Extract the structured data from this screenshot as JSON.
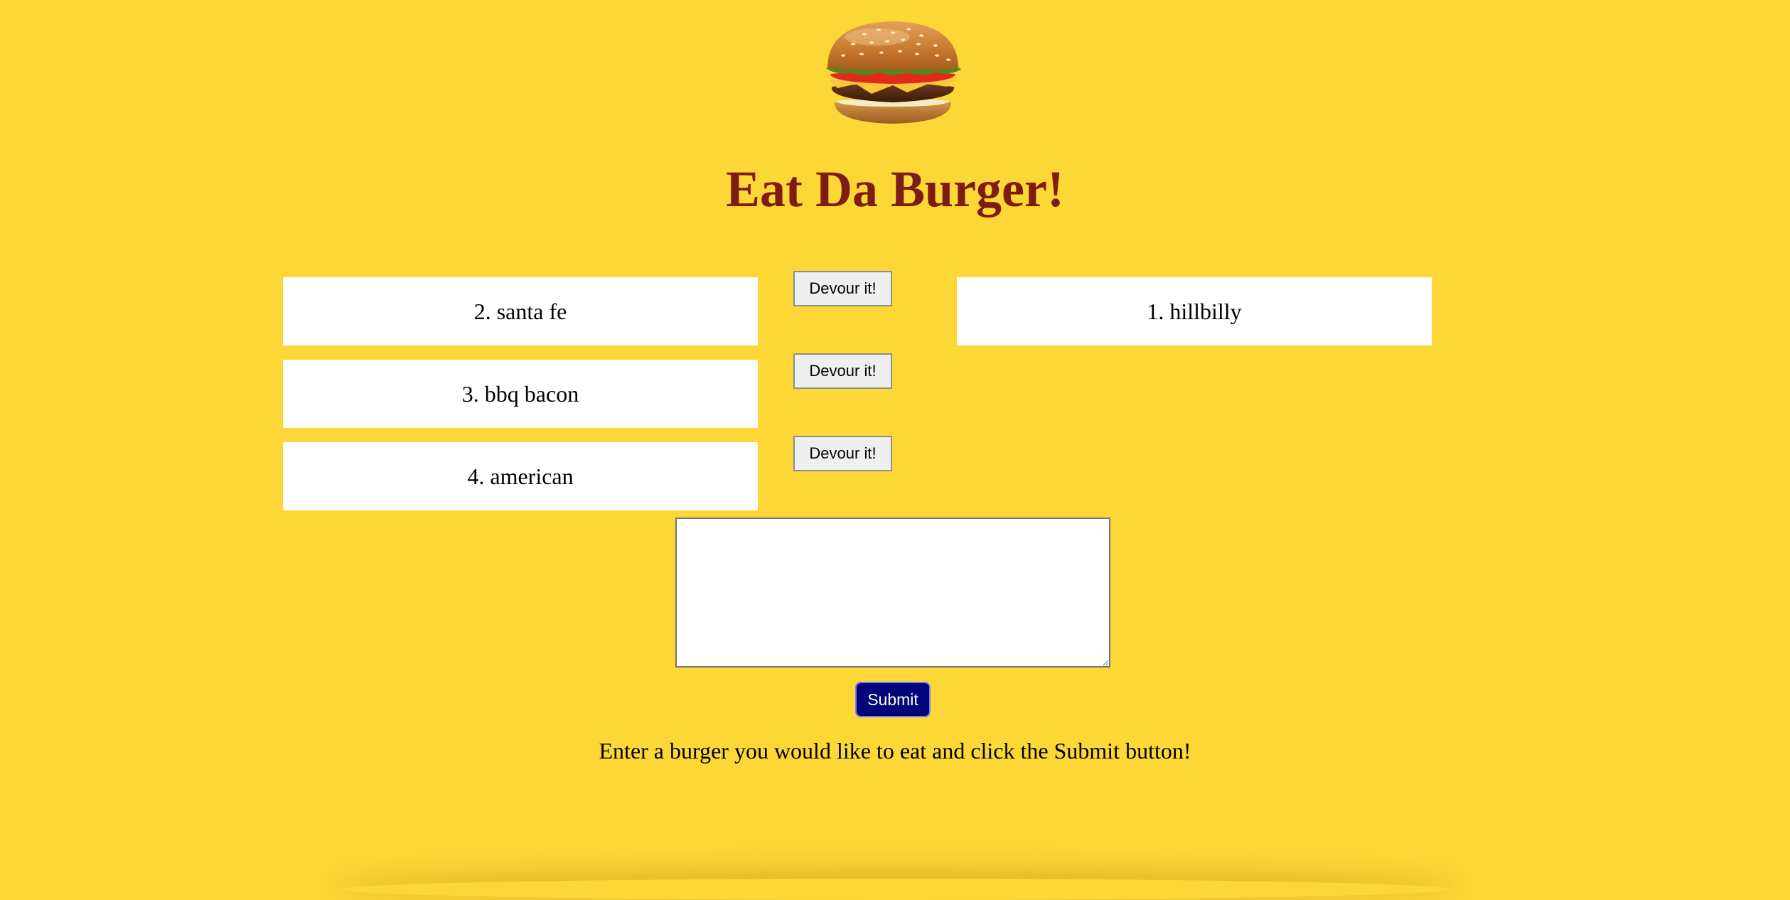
{
  "colors": {
    "background": "#fdd735",
    "title": "#7e1b13",
    "submit_background": "#02057a",
    "card_background": "#ffffff"
  },
  "header": {
    "logo_icon": "hamburger-icon",
    "title": "Eat Da Burger!"
  },
  "uneaten_burgers": [
    {
      "label": "2. santa fe",
      "button_label": "Devour it!"
    },
    {
      "label": "3. bbq bacon",
      "button_label": "Devour it!"
    },
    {
      "label": "4. american",
      "button_label": "Devour it!"
    }
  ],
  "devoured_burgers": [
    {
      "label": "1. hillbilly"
    }
  ],
  "form": {
    "textarea_value": "",
    "textarea_placeholder": "",
    "submit_label": "Submit",
    "hint": "Enter a burger you would like to eat and click the Submit button!"
  }
}
